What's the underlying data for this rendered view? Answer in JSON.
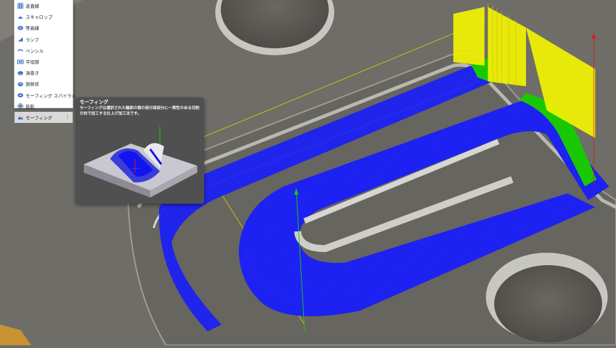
{
  "menu": {
    "items": [
      {
        "label": "走査線",
        "icon": "parallel-icon",
        "color": "#3b6fd0"
      },
      {
        "label": "スキャロップ",
        "icon": "scallop-icon",
        "color": "#3b6fd0"
      },
      {
        "label": "等高線",
        "icon": "contour-icon",
        "color": "#3b6fd0"
      },
      {
        "label": "ランプ",
        "icon": "ramp-icon",
        "color": "#3b6fd0"
      },
      {
        "label": "ペンシル",
        "icon": "pencil-icon",
        "color": "#3b6fd0"
      },
      {
        "label": "平坦部",
        "icon": "flat-icon",
        "color": "#3b6fd0"
      },
      {
        "label": "渦巻き",
        "icon": "spiral-icon",
        "color": "#3b6fd0"
      },
      {
        "label": "放射状",
        "icon": "radial-icon",
        "color": "#3b6fd0"
      },
      {
        "label": "モーフィング スパイラル",
        "icon": "morphed-spiral-icon",
        "color": "#3b6fd0"
      },
      {
        "label": "投影",
        "icon": "project-icon",
        "color": "#3b6fd0"
      },
      {
        "label": "モーフィング",
        "icon": "morph-icon",
        "color": "#3b6fd0",
        "selected": true
      }
    ],
    "more_icon": "⋮"
  },
  "tooltip": {
    "title": "モーフィング",
    "description": "モーフィングは選択された輪郭の間の部分面部分に一貫性のある切削方向で加工する仕上げ加工法です。"
  },
  "colors": {
    "toolpath": "#0a10f0",
    "rapid": "#f5f500",
    "link": "#19c800",
    "part": "#6f6d67"
  }
}
